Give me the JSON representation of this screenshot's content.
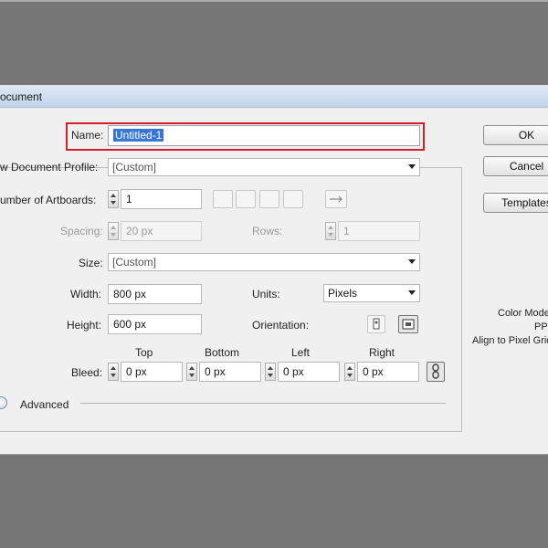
{
  "dialog": {
    "title": "ocument"
  },
  "form": {
    "name_label": "Name:",
    "name_value": "Untitled-1",
    "profile_label": "w Document Profile:",
    "profile_value": "[Custom]",
    "artboards_label": "umber of Artboards:",
    "artboards_value": "1",
    "spacing_label": "Spacing:",
    "spacing_value": "20 px",
    "rows_label": "Rows:",
    "rows_value": "1",
    "size_label": "Size:",
    "size_value": "[Custom]",
    "width_label": "Width:",
    "width_value": "800 px",
    "units_label": "Units:",
    "units_value": "Pixels",
    "height_label": "Height:",
    "height_value": "600 px",
    "orientation_label": "Orientation:",
    "bleed_label": "Bleed:",
    "bleed": {
      "top_label": "Top",
      "top_value": "0 px",
      "bottom_label": "Bottom",
      "bottom_value": "0 px",
      "left_label": "Left",
      "left_value": "0 px",
      "right_label": "Right",
      "right_value": "0 px"
    },
    "advanced_label": "Advanced"
  },
  "buttons": {
    "ok": "OK",
    "cancel": "Cancel",
    "templates": "Templates"
  },
  "info": {
    "color_mode": "Color Mode",
    "ppi": "PPI",
    "align": "Align to Pixel Grid"
  },
  "highlight": {
    "color": "#d0202a"
  },
  "icons": [
    "grid-by-row-icon",
    "grid-by-column-icon",
    "arrange-by-row-icon",
    "arrange-by-column-icon",
    "left-to-right-icon",
    "portrait-icon",
    "landscape-icon",
    "link-icon",
    "chevron-down-icon"
  ]
}
